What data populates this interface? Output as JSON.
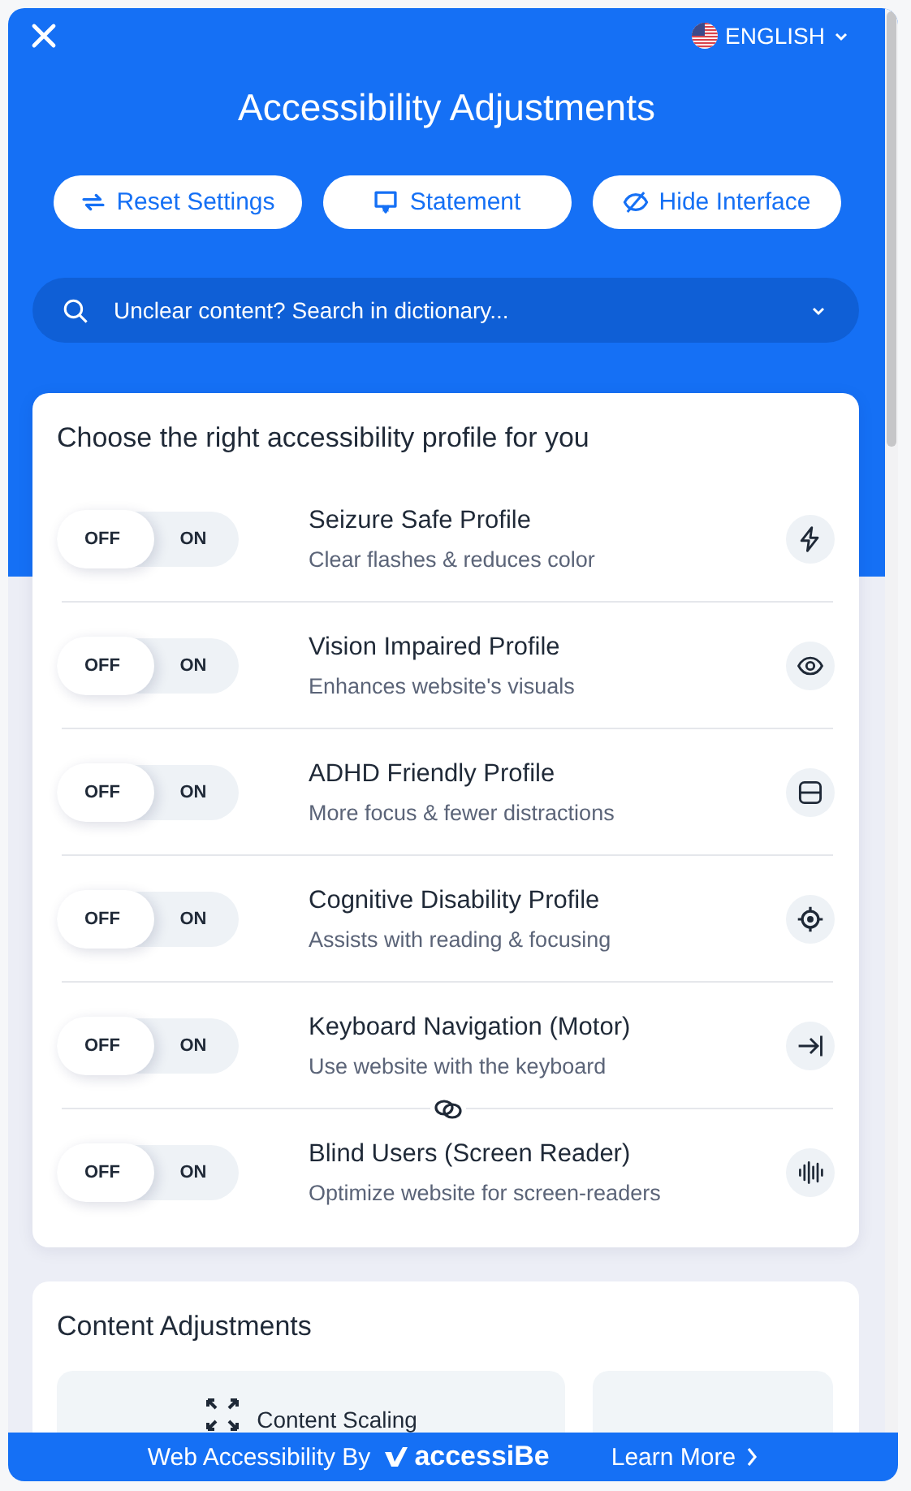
{
  "language": {
    "label": "ENGLISH"
  },
  "title": "Accessibility Adjustments",
  "buttons": [
    {
      "label": "Reset Settings",
      "kind": "reset"
    },
    {
      "label": "Statement",
      "kind": "statement"
    },
    {
      "label": "Hide Interface",
      "kind": "hide"
    }
  ],
  "search": {
    "placeholder": "Unclear content? Search in dictionary..."
  },
  "profiles": {
    "title": "Choose the right accessibility profile for you",
    "items": [
      {
        "name": "Seizure Safe Profile",
        "description": "Clear flashes & reduces color",
        "off_label": "OFF",
        "on_label": "ON",
        "on": false,
        "kind": "bolt"
      },
      {
        "name": "Vision Impaired Profile",
        "description": "Enhances website's visuals",
        "off_label": "OFF",
        "on_label": "ON",
        "on": false,
        "kind": "eye"
      },
      {
        "name": "ADHD Friendly Profile",
        "description": "More focus & fewer distractions",
        "off_label": "OFF",
        "on_label": "ON",
        "on": false,
        "kind": "focus"
      },
      {
        "name": "Cognitive Disability Profile",
        "description": "Assists with reading & focusing",
        "off_label": "OFF",
        "on_label": "ON",
        "on": false,
        "kind": "target"
      },
      {
        "name": "Keyboard Navigation (Motor)",
        "description": "Use website with the keyboard",
        "off_label": "OFF",
        "on_label": "ON",
        "on": false,
        "kind": "tab"
      },
      {
        "name": "Blind Users (Screen Reader)",
        "description": "Optimize website for screen-readers",
        "off_label": "OFF",
        "on_label": "ON",
        "on": false,
        "kind": "wave"
      }
    ]
  },
  "content_adjustments": {
    "title": "Content Adjustments",
    "tiles": [
      {
        "kind": "scaling",
        "label": "Content Scaling"
      },
      {
        "kind": "blank"
      }
    ]
  },
  "footer": {
    "text": "Web Accessibility By",
    "brand": "accessiBe",
    "link": "Learn More"
  }
}
